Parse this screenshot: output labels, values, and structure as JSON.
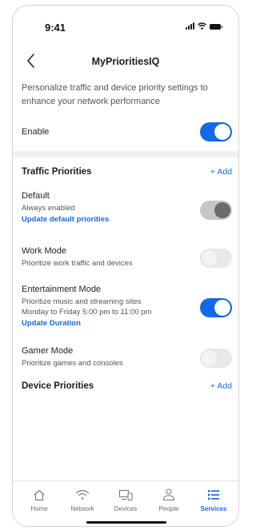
{
  "status": {
    "time": "9:41"
  },
  "header": {
    "title": "MyPrioritiesIQ"
  },
  "description": "Personalize traffic and device priority settings to enhance your network performance",
  "enable": {
    "label": "Enable",
    "state": "on"
  },
  "traffic": {
    "heading": "Traffic Priorities",
    "add_label": "+ Add",
    "items": [
      {
        "name": "Default",
        "sub": "Always enabled",
        "link": "Update default priorities",
        "state": "disabled"
      },
      {
        "name": "Work Mode",
        "sub": "Prioritize work traffic and devices",
        "state": "off"
      },
      {
        "name": "Entertainment Mode",
        "sub": "Prioritize music and streaming sites",
        "sub2": "Monday to Friday 5:00 pm to 11:00 pm",
        "link": "Update Duration",
        "state": "on"
      },
      {
        "name": "Gamer Mode",
        "sub": "Prioritize games and consoles",
        "state": "off"
      }
    ]
  },
  "devices": {
    "heading": "Device Priorities",
    "add_label": "+ Add"
  },
  "tabbar": {
    "tabs": [
      {
        "label": "Home",
        "icon": "home-icon"
      },
      {
        "label": "Network",
        "icon": "wifi-icon"
      },
      {
        "label": "Devices",
        "icon": "devices-icon"
      },
      {
        "label": "People",
        "icon": "people-icon"
      },
      {
        "label": "Services",
        "icon": "list-icon",
        "active": true
      }
    ]
  },
  "colors": {
    "accent": "#1469e6",
    "link": "#1a6ae0",
    "band": "#f1f1f3"
  }
}
